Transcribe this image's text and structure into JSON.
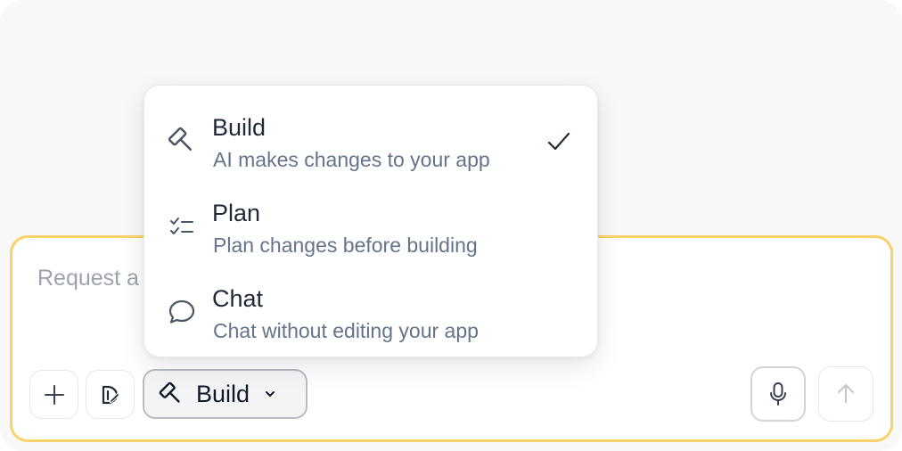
{
  "composer": {
    "placeholder": "Request a",
    "add_icon": "plus-icon",
    "visual_icon": "visual-edit-icon",
    "mode_button": {
      "label": "Build",
      "icon": "hammer-icon",
      "chevron": "chevron-down-icon"
    },
    "mic_icon": "microphone-icon",
    "send_icon": "arrow-up-icon"
  },
  "mode_menu": {
    "items": [
      {
        "title": "Build",
        "description": "AI makes changes to your app",
        "icon": "hammer-icon",
        "selected": true
      },
      {
        "title": "Plan",
        "description": "Plan changes before building",
        "icon": "checklist-icon",
        "selected": false
      },
      {
        "title": "Chat",
        "description": "Chat without editing your app",
        "icon": "chat-bubble-icon",
        "selected": false
      }
    ]
  },
  "colors": {
    "composer_border": "#f8d36b",
    "text_primary": "#1f2937",
    "text_secondary": "#64748b",
    "panel_bg": "#f8f8f9"
  }
}
